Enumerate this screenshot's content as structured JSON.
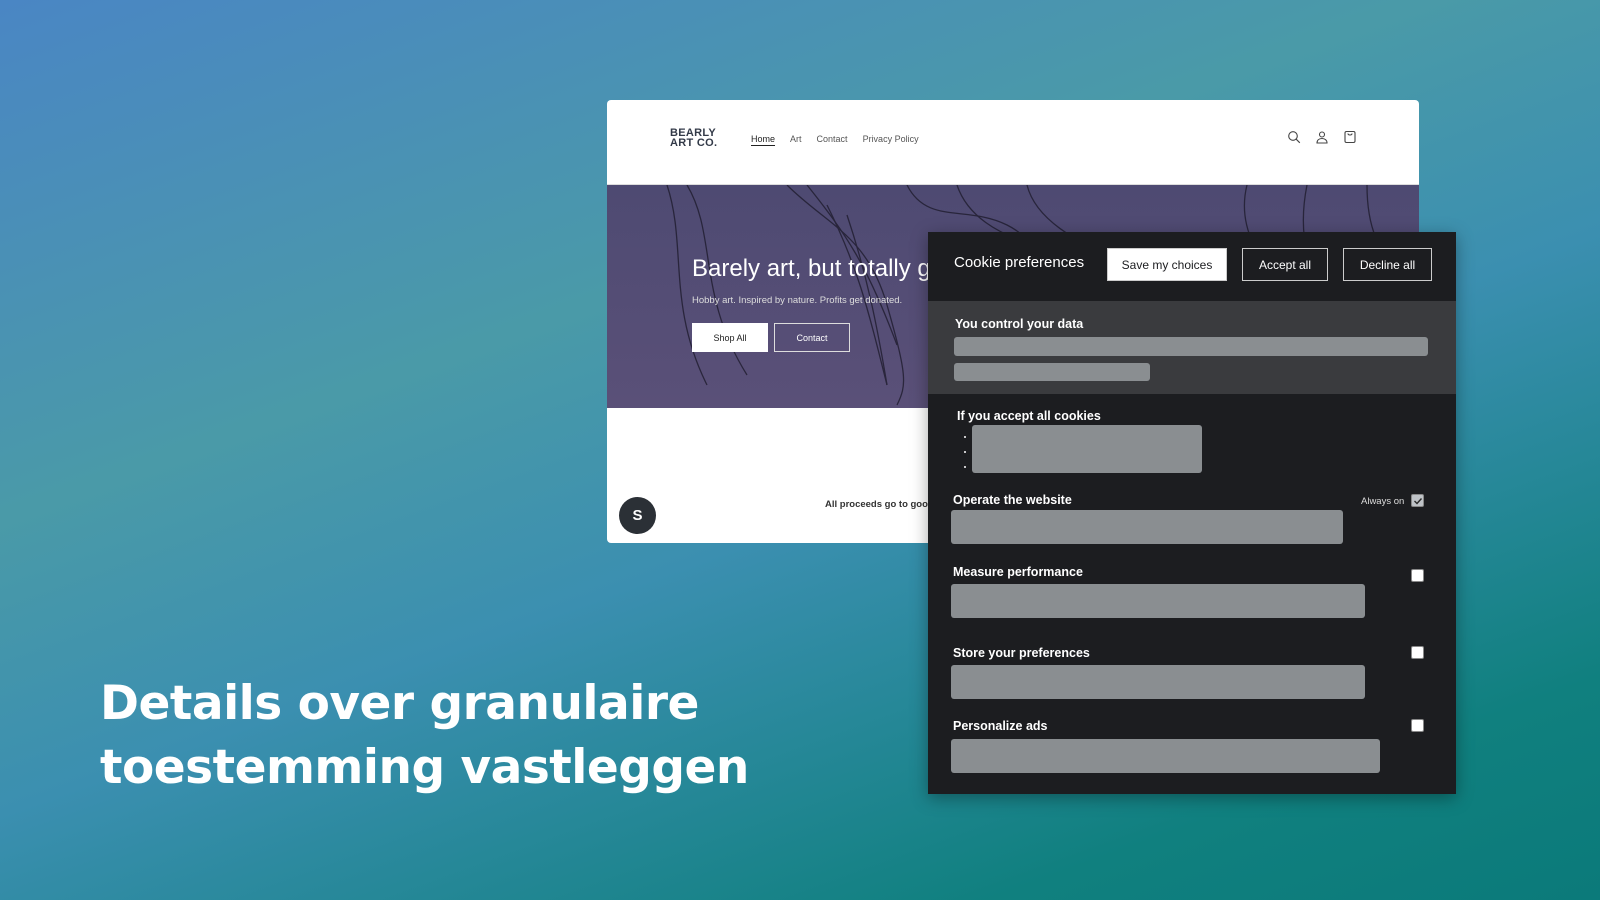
{
  "headline": {
    "line1": "Details over granulaire",
    "line2": "toestemming vastleggen"
  },
  "site": {
    "logo": {
      "line1": "BEARLY",
      "line2": "ART CO."
    },
    "nav": [
      "Home",
      "Art",
      "Contact",
      "Privacy Policy"
    ],
    "icons": [
      "search-icon",
      "account-icon",
      "cart-icon"
    ],
    "hero": {
      "title": "Barely art, but totally g",
      "subtitle": "Hobby art. Inspired by nature. Profits get donated.",
      "shop_all": "Shop All",
      "contact": "Contact"
    },
    "proceeds": "All proceeds go to goo"
  },
  "cookie": {
    "title": "Cookie preferences",
    "save": "Save my choices",
    "accept": "Accept all",
    "decline": "Decline all",
    "control": "You control your data",
    "accept_all_heading": "If you accept all cookies",
    "categories": [
      {
        "label": "Operate the website",
        "status": "Always on",
        "checked": true
      },
      {
        "label": "Measure performance",
        "checked": false
      },
      {
        "label": "Store your preferences",
        "checked": false
      },
      {
        "label": "Personalize ads",
        "checked": false
      }
    ]
  }
}
